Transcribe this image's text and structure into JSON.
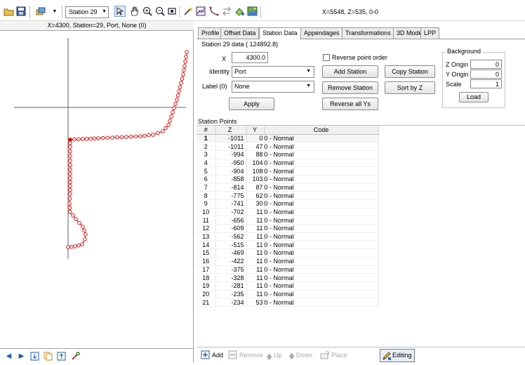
{
  "toolbar": {
    "station_select": "Station 29",
    "coord_readout": "X=5548, Z=535, 0-0",
    "icons": [
      "open-folder-icon",
      "save-icon",
      "layers-icon",
      "dropdown-arrow-icon",
      "select-arrow-icon",
      "pan-hand-icon",
      "zoom-in-icon",
      "zoom-out-icon",
      "zoom-extents-icon",
      "wand-icon",
      "chart-icon",
      "curve-icon",
      "arrows-icon",
      "paint-icon",
      "image-icon"
    ]
  },
  "left_panel": {
    "title": "X=4300, Station=29, Port, None (0)",
    "bottom_icons": [
      "arrow-left-icon",
      "arrow-right-icon",
      "import-icon",
      "copy-icon",
      "export-icon",
      "tool-icon"
    ]
  },
  "tabs": [
    "Profile",
    "Offset Data",
    "Station Data",
    "Appendages",
    "Transformations",
    "3D Model",
    "LPP"
  ],
  "active_tab": "Station Data",
  "station_form": {
    "title": "Station 29 data ( 124892.8)",
    "x_label": "X",
    "x_value": "4300.0",
    "identity_label": "Identity",
    "identity_value": "Port",
    "label_label": "Label (0)",
    "label_value": "None",
    "apply_label": "Apply",
    "reverse_point_order_label": "Reverse point order",
    "reverse_point_order_checked": false,
    "add_station_label": "Add Station",
    "copy_station_label": "Copy Station",
    "remove_station_label": "Remove Station",
    "sort_by_z_label": "Sort by Z",
    "reverse_all_ys_label": "Reverse all Ys"
  },
  "background": {
    "legend": "Background",
    "z_origin_label": "Z Origin",
    "z_origin_value": "0",
    "y_origin_label": "Y Origin",
    "y_origin_value": "0",
    "scale_label": "Scale",
    "scale_value": "1",
    "load_label": "Load"
  },
  "station_points": {
    "title": "Station Points",
    "columns": [
      "#",
      "Z",
      "Y",
      "Code"
    ],
    "rows": [
      [
        "1",
        "-1011",
        "0",
        "0 - Normal"
      ],
      [
        "2",
        "-1011",
        "47",
        "0 - Normal"
      ],
      [
        "3",
        "-994",
        "88",
        "0 - Normal"
      ],
      [
        "4",
        "-950",
        "104",
        "0 - Normal"
      ],
      [
        "5",
        "-904",
        "108",
        "0 - Normal"
      ],
      [
        "6",
        "-858",
        "103",
        "0 - Normal"
      ],
      [
        "7",
        "-814",
        "87",
        "0 - Normal"
      ],
      [
        "8",
        "-775",
        "62",
        "0 - Normal"
      ],
      [
        "9",
        "-741",
        "30",
        "0 - Normal"
      ],
      [
        "10",
        "-702",
        "11",
        "0 - Normal"
      ],
      [
        "11",
        "-656",
        "11",
        "0 - Normal"
      ],
      [
        "12",
        "-609",
        "11",
        "0 - Normal"
      ],
      [
        "13",
        "-562",
        "11",
        "0 - Normal"
      ],
      [
        "14",
        "-515",
        "11",
        "0 - Normal"
      ],
      [
        "15",
        "-469",
        "11",
        "0 - Normal"
      ],
      [
        "16",
        "-422",
        "11",
        "0 - Normal"
      ],
      [
        "17",
        "-375",
        "11",
        "0 - Normal"
      ],
      [
        "18",
        "-328",
        "11",
        "0 - Normal"
      ],
      [
        "19",
        "-281",
        "11",
        "0 - Normal"
      ],
      [
        "20",
        "-235",
        "11",
        "0 - Normal"
      ],
      [
        "21",
        "-234",
        "53",
        "0 - Normal"
      ]
    ]
  },
  "bottom_bar": {
    "add_label": "Add",
    "remove_label": "Remove",
    "up_label": "Up",
    "down_label": "Down",
    "place_label": "Place",
    "editing_label": "Editing"
  },
  "colors": {
    "curve": "#e00000",
    "selection": "#cde6f7"
  }
}
